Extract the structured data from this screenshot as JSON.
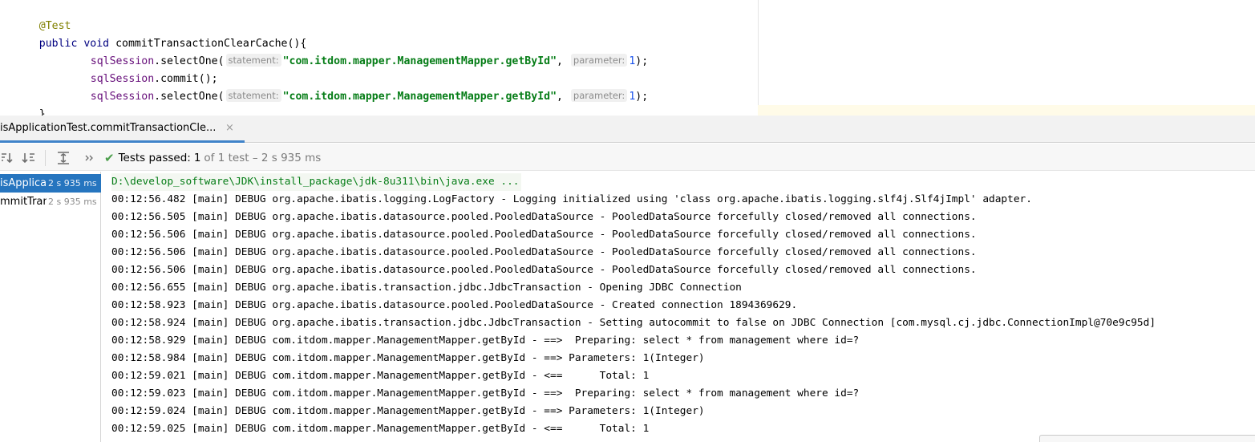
{
  "editor": {
    "lines": [
      {
        "annotation": "@Test"
      },
      {
        "kw1": "public",
        "kw2": "void",
        "method": "commitTransactionClearCache(){"
      },
      {
        "obj": "sqlSession",
        "call": ".selectOne(",
        "hint1": "statement:",
        "str": "\"com.itdom.mapper.ManagementMapper.getById\"",
        "comma": ",",
        "hint2": "parameter:",
        "num": "1",
        "tail": ");"
      },
      {
        "obj": "sqlSession",
        "call": ".commit();"
      },
      {
        "obj": "sqlSession",
        "call": ".selectOne(",
        "hint1": "statement:",
        "str": "\"com.itdom.mapper.ManagementMapper.getById\"",
        "comma": ",",
        "hint2": "parameter:",
        "num": "1",
        "tail": ");"
      },
      {
        "close": "}"
      }
    ]
  },
  "run": {
    "tab_label": "isApplicationTest.commitTransactionCle...",
    "close_glyph": "×",
    "status": {
      "passed_label": "Tests passed:",
      "passed_count": "1",
      "detail": "of 1 test – 2 s 935 ms"
    },
    "toolbar_icons": [
      "sort-alpha-icon",
      "sort-duration-icon",
      "expand-all-icon",
      "more-chevron-icon"
    ],
    "tree": [
      {
        "name": "isApplica",
        "duration": "2 s 935 ms",
        "selected": true
      },
      {
        "name": "mmitTran",
        "duration": "2 s 935 ms",
        "selected": false
      }
    ],
    "console": [
      "D:\\develop_software\\JDK\\install_package\\jdk-8u311\\bin\\java.exe ...",
      "00:12:56.482 [main] DEBUG org.apache.ibatis.logging.LogFactory - Logging initialized using 'class org.apache.ibatis.logging.slf4j.Slf4jImpl' adapter.",
      "00:12:56.505 [main] DEBUG org.apache.ibatis.datasource.pooled.PooledDataSource - PooledDataSource forcefully closed/removed all connections.",
      "00:12:56.506 [main] DEBUG org.apache.ibatis.datasource.pooled.PooledDataSource - PooledDataSource forcefully closed/removed all connections.",
      "00:12:56.506 [main] DEBUG org.apache.ibatis.datasource.pooled.PooledDataSource - PooledDataSource forcefully closed/removed all connections.",
      "00:12:56.506 [main] DEBUG org.apache.ibatis.datasource.pooled.PooledDataSource - PooledDataSource forcefully closed/removed all connections.",
      "00:12:56.655 [main] DEBUG org.apache.ibatis.transaction.jdbc.JdbcTransaction - Opening JDBC Connection",
      "00:12:58.923 [main] DEBUG org.apache.ibatis.datasource.pooled.PooledDataSource - Created connection 1894369629.",
      "00:12:58.924 [main] DEBUG org.apache.ibatis.transaction.jdbc.JdbcTransaction - Setting autocommit to false on JDBC Connection [com.mysql.cj.jdbc.ConnectionImpl@70e9c95d]",
      "00:12:58.929 [main] DEBUG com.itdom.mapper.ManagementMapper.getById - ==>  Preparing: select * from management where id=?",
      "00:12:58.984 [main] DEBUG com.itdom.mapper.ManagementMapper.getById - ==> Parameters: 1(Integer)",
      "00:12:59.021 [main] DEBUG com.itdom.mapper.ManagementMapper.getById - <==      Total: 1",
      "00:12:59.023 [main] DEBUG com.itdom.mapper.ManagementMapper.getById - ==>  Preparing: select * from management where id=?",
      "00:12:59.024 [main] DEBUG com.itdom.mapper.ManagementMapper.getById - ==> Parameters: 1(Integer)",
      "00:12:59.025 [main] DEBUG com.itdom.mapper.ManagementMapper.getById - <==      Total: 1"
    ]
  }
}
